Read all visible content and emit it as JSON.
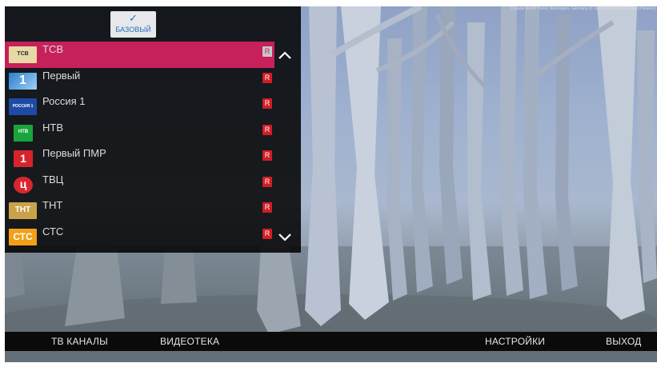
{
  "credit_text": "Coastal beech forest, Nienhagen, Germany (© Sandra Bartocha/Minden Pictures)",
  "package_label": "БАЗОВЫЙ",
  "channels": [
    {
      "name": "ТСВ",
      "badge": "R",
      "logo_text": "ТСВ",
      "selected": true
    },
    {
      "name": "Первый",
      "badge": "R",
      "logo_text": "1"
    },
    {
      "name": "Россия 1",
      "badge": "R",
      "logo_text": "РОССИЯ 1"
    },
    {
      "name": "НТВ",
      "badge": "R",
      "logo_text": "НТВ"
    },
    {
      "name": "Первый ПМР",
      "badge": "R",
      "logo_text": "1"
    },
    {
      "name": "ТВЦ",
      "badge": "R",
      "logo_text": "ц"
    },
    {
      "name": "ТНТ",
      "badge": "R",
      "logo_text": "ТНТ"
    },
    {
      "name": "СТС",
      "badge": "R",
      "logo_text": "СТС"
    }
  ],
  "nav": {
    "tv_channels": "ТВ КАНАЛЫ",
    "video_library": "ВИДЕОТЕКА",
    "settings": "НАСТРОЙКИ",
    "exit": "ВЫХОД"
  },
  "colors": {
    "selected_row": "#c7205a",
    "badge": "#d01d26",
    "panel": "#000000"
  }
}
